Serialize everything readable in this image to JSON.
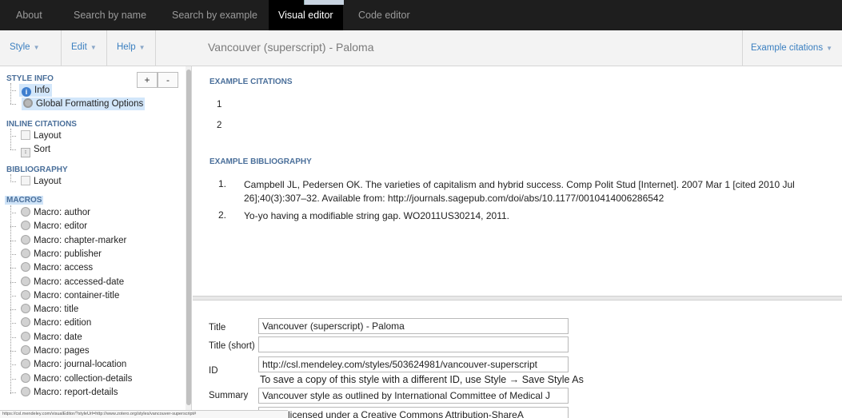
{
  "topnav": {
    "tabs": [
      {
        "label": "About"
      },
      {
        "label": "Search by name"
      },
      {
        "label": "Search by example"
      },
      {
        "label": "Visual editor"
      },
      {
        "label": "Code editor"
      }
    ]
  },
  "toolbar": {
    "style_menu": "Style",
    "edit_menu": "Edit",
    "help_menu": "Help",
    "style_title": "Vancouver (superscript) - Paloma",
    "example_citations": "Example citations"
  },
  "tree": {
    "add_button": "+",
    "remove_button": "-",
    "style_info": {
      "heading": "STYLE INFO",
      "items": [
        "Info",
        "Global Formatting Options"
      ]
    },
    "inline_citations": {
      "heading": "INLINE CITATIONS",
      "items": [
        "Layout",
        "Sort"
      ]
    },
    "bibliography": {
      "heading": "BIBLIOGRAPHY",
      "items": [
        "Layout"
      ]
    },
    "macros": {
      "heading": "MACROS",
      "items": [
        "Macro: author",
        "Macro: editor",
        "Macro: chapter-marker",
        "Macro: publisher",
        "Macro: access",
        "Macro: accessed-date",
        "Macro: container-title",
        "Macro: title",
        "Macro: edition",
        "Macro: date",
        "Macro: pages",
        "Macro: journal-location",
        "Macro: collection-details",
        "Macro: report-details"
      ]
    }
  },
  "preview": {
    "citations_heading": "EXAMPLE CITATIONS",
    "citations": [
      "1",
      "2"
    ],
    "bibliography_heading": "EXAMPLE BIBLIOGRAPHY",
    "bibliography": [
      {
        "num": "1.",
        "text": "Campbell JL, Pedersen OK. The varieties of capitalism and hybrid success. Comp Polit Stud [Internet]. 2007 Mar 1 [cited 2010 Jul 26];40(3):307–32. Available from: http://journals.sagepub.com/doi/abs/10.1177/0010414006286542"
      },
      {
        "num": "2.",
        "text": "Yo-yo having a modifiable string gap. WO2011US30214, 2011."
      }
    ]
  },
  "form": {
    "title_label": "Title",
    "title_value": "Vancouver (superscript) - Paloma",
    "title_short_label": "Title (short)",
    "title_short_value": "",
    "id_label": "ID",
    "id_value": "http://csl.mendeley.com/styles/503624981/vancouver-superscript",
    "id_note": "To save a copy of this style with a different ID, use Style → Save Style As",
    "summary_label": "Summary",
    "summary_value": "Vancouver style as outlined by International Committee of Medical J",
    "rights_value": "ork is licensed under a Creative Commons Attribution-ShareA"
  },
  "status_url": "https://csl.mendeley.com/visualEditor/?styleUrl=http://www.zotero.org/styles/vancouver-superscript#"
}
